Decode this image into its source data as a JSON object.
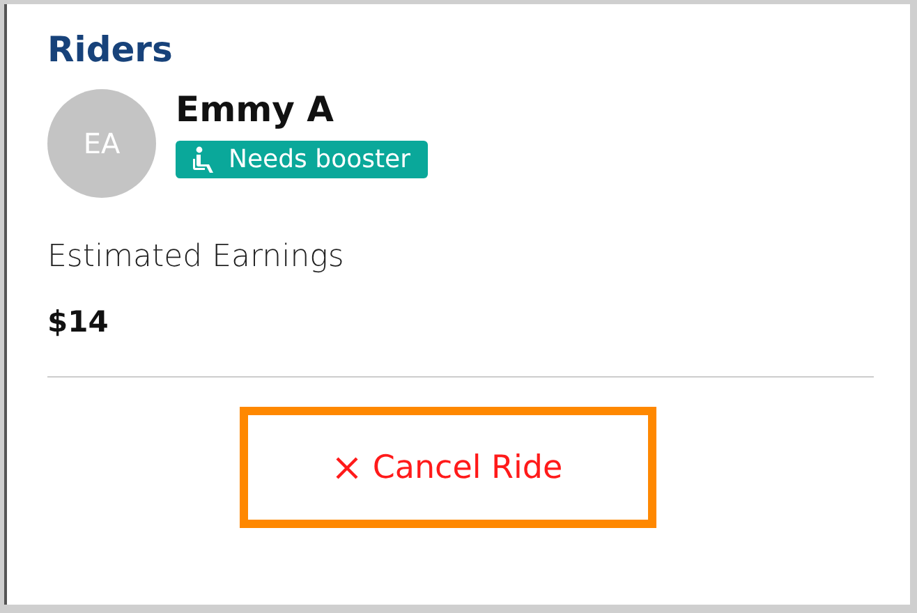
{
  "section_title": "Riders",
  "riders": [
    {
      "initials": "EA",
      "name": "Emmy A",
      "tags": [
        {
          "label": "Needs booster",
          "color": "#0aa89a"
        }
      ]
    }
  ],
  "earnings": {
    "label": "Estimated Earnings",
    "amount": "$14"
  },
  "cancel_button": {
    "label": "Cancel Ride",
    "highlighted": true
  }
}
